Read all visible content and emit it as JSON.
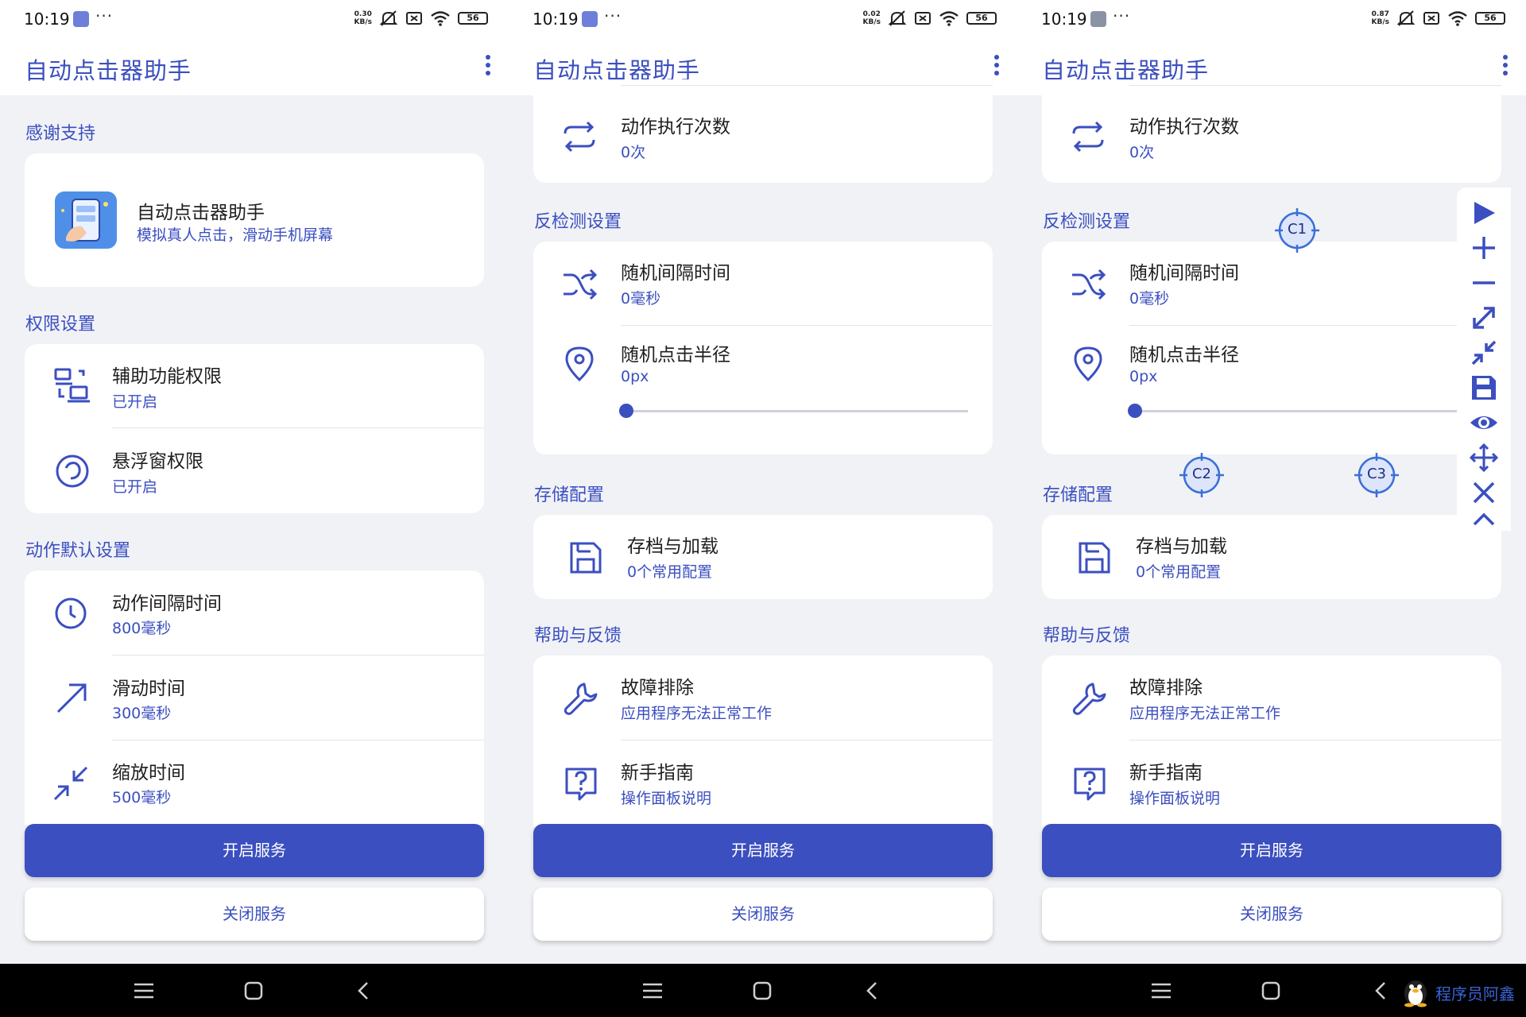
{
  "status": {
    "time": "10:19",
    "battery": "56",
    "speed": [
      "0.30",
      "0.02",
      "0.87"
    ],
    "speed_unit": "KB/s"
  },
  "app": {
    "title": "自动点击器助手"
  },
  "screen1": {
    "sections": {
      "thanks": "感谢支持",
      "permissions": "权限设置",
      "defaults": "动作默认设置"
    },
    "app_card": {
      "name": "自动点击器助手",
      "desc": "模拟真人点击，滑动手机屏幕"
    },
    "permission_items": [
      {
        "title": "辅助功能权限",
        "sub": "已开启"
      },
      {
        "title": "悬浮窗权限",
        "sub": "已开启"
      }
    ],
    "default_items": [
      {
        "title": "动作间隔时间",
        "sub": "800毫秒"
      },
      {
        "title": "滑动时间",
        "sub": "300毫秒"
      },
      {
        "title": "缩放时间",
        "sub": "500毫秒"
      }
    ]
  },
  "screen2": {
    "exec_count": {
      "title": "动作执行次数",
      "sub": "0次"
    },
    "sections": {
      "anti": "反检测设置",
      "storage": "存储配置",
      "help": "帮助与反馈"
    },
    "anti_items": [
      {
        "title": "随机间隔时间",
        "sub": "0毫秒"
      },
      {
        "title": "随机点击半径",
        "sub": "0px"
      }
    ],
    "radius_slider_value": 0,
    "storage_item": {
      "title": "存档与加载",
      "sub": "0个常用配置"
    },
    "help_items": [
      {
        "title": "故障排除",
        "sub": "应用程序无法正常工作"
      },
      {
        "title": "新手指南",
        "sub": "操作面板说明"
      }
    ]
  },
  "buttons": {
    "start": "开启服务",
    "stop": "关闭服务"
  },
  "targets": [
    "C1",
    "C2",
    "C3"
  ],
  "floating_panel_icons": [
    "play-icon",
    "plus-icon",
    "minus-icon",
    "expand-icon",
    "collapse-icon",
    "save-icon",
    "eye-icon",
    "move-icon",
    "close-icon",
    "chevron-up-icon"
  ],
  "watermark": "程序员阿鑫",
  "colors": {
    "accent": "#3b4fc0",
    "background": "#f1f2f6",
    "card": "#ffffff",
    "navbar": "#000000"
  }
}
